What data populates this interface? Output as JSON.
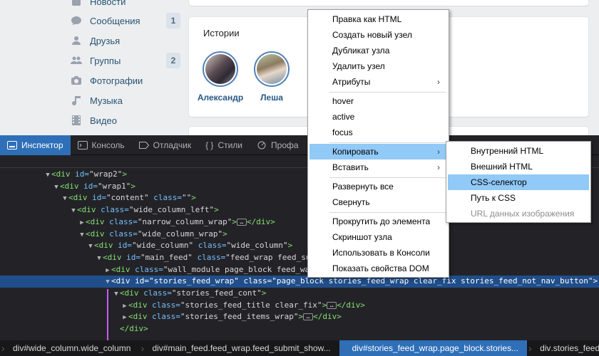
{
  "sidebar": {
    "items": [
      {
        "label": "Новости",
        "icon": "news-icon",
        "count": ""
      },
      {
        "label": "Сообщения",
        "icon": "messages-icon",
        "count": "1"
      },
      {
        "label": "Друзья",
        "icon": "friends-icon",
        "count": ""
      },
      {
        "label": "Группы",
        "icon": "groups-icon",
        "count": "2"
      },
      {
        "label": "Фотографии",
        "icon": "camera-icon",
        "count": ""
      },
      {
        "label": "Музыка",
        "icon": "music-note-icon",
        "count": ""
      },
      {
        "label": "Видео",
        "icon": "video-film-icon",
        "count": ""
      }
    ]
  },
  "stories": {
    "title": "Истории",
    "people": [
      {
        "name": "Александр"
      },
      {
        "name": "Леша"
      }
    ]
  },
  "devtools": {
    "tabs": [
      {
        "label": "Инспектор",
        "icon": "inspector-icon"
      },
      {
        "label": "Консоль",
        "icon": "console-icon"
      },
      {
        "label": "Отладчик",
        "icon": "debugger-icon"
      },
      {
        "label": "Стили",
        "icon": "style-editor-icon"
      },
      {
        "label": "Профа",
        "icon": "performance-icon"
      }
    ],
    "markup": [
      {
        "parts": [
          [
            "tg",
            "<div "
          ],
          [
            "at",
            "id="
          ],
          [
            "vl",
            "\"wrap2\""
          ],
          [
            "tg",
            ">"
          ]
        ]
      },
      {
        "parts": [
          [
            "tg",
            "<div "
          ],
          [
            "at",
            "id="
          ],
          [
            "vl",
            "\"wrap1\""
          ],
          [
            "tg",
            ">"
          ]
        ]
      },
      {
        "parts": [
          [
            "tg",
            "<div "
          ],
          [
            "at",
            "id="
          ],
          [
            "vl",
            "\"content\" "
          ],
          [
            "at",
            "class="
          ],
          [
            "vl",
            "\"\""
          ],
          [
            "tg",
            ">"
          ]
        ]
      },
      {
        "parts": [
          [
            "tg",
            "<div "
          ],
          [
            "at",
            "class="
          ],
          [
            "vl",
            "\"wide_column_left\""
          ],
          [
            "tg",
            ">"
          ]
        ]
      },
      {
        "parts": [
          [
            "tg",
            "<div "
          ],
          [
            "at",
            "class="
          ],
          [
            "vl",
            "\"narrow_column_wrap\""
          ],
          [
            "tg",
            ">"
          ],
          [
            "ell",
            "…"
          ],
          [
            "tg",
            "</div>"
          ]
        ]
      },
      {
        "parts": [
          [
            "tg",
            "<div "
          ],
          [
            "at",
            "class="
          ],
          [
            "vl",
            "\"wide_column_wrap\""
          ],
          [
            "tg",
            ">"
          ]
        ]
      },
      {
        "parts": [
          [
            "tg",
            "<div "
          ],
          [
            "at",
            "id="
          ],
          [
            "vl",
            "\"wide_column\" "
          ],
          [
            "at",
            "class="
          ],
          [
            "vl",
            "\"wide_column\""
          ],
          [
            "tg",
            ">"
          ]
        ]
      },
      {
        "parts": [
          [
            "tg",
            "<div "
          ],
          [
            "at",
            "id="
          ],
          [
            "vl",
            "\"main_feed\" "
          ],
          [
            "at",
            "class="
          ],
          [
            "vl",
            "\"feed_wrap feed_submit_shown\""
          ],
          [
            "tg",
            ">"
          ]
        ]
      },
      {
        "parts": [
          [
            "tg",
            "<div "
          ],
          [
            "at",
            "class="
          ],
          [
            "vl",
            "\"wall_module page_block feed_wall\""
          ],
          [
            "tg",
            ">"
          ]
        ]
      },
      {
        "parts": [
          [
            "tg",
            "<div "
          ],
          [
            "at",
            "id="
          ],
          [
            "vl",
            "\"stories_feed_wrap\" "
          ],
          [
            "at",
            "class="
          ],
          [
            "vl",
            "\"page_block stories_feed_wrap clear_fix stories_feed_not_nav_button\""
          ],
          [
            "tg",
            ">"
          ]
        ]
      },
      {
        "parts": [
          [
            "tg",
            "<div "
          ],
          [
            "at",
            "class="
          ],
          [
            "vl",
            "\"stories_feed_cont\""
          ],
          [
            "tg",
            ">"
          ]
        ]
      },
      {
        "parts": [
          [
            "tg",
            "<div "
          ],
          [
            "at",
            "class="
          ],
          [
            "vl",
            "\"stories_feed_title clear_fix\""
          ],
          [
            "tg",
            ">"
          ],
          [
            "ell",
            "…"
          ],
          [
            "tg",
            "</div>"
          ]
        ]
      },
      {
        "parts": [
          [
            "tg",
            "<div "
          ],
          [
            "at",
            "class="
          ],
          [
            "vl",
            "\"stories_feed_items_wrap\""
          ],
          [
            "tg",
            ">"
          ],
          [
            "ell",
            "…"
          ],
          [
            "tg",
            "</div>"
          ]
        ]
      },
      {
        "parts": [
          [
            "tg",
            "</div>"
          ]
        ]
      }
    ],
    "breadcrumbs": [
      {
        "tag": "div",
        "rest": "#wide_column.wide_column"
      },
      {
        "tag": "div",
        "rest": "#main_feed.feed_wrap.feed_submit_show..."
      },
      {
        "tag": "div",
        "rest": "#stories_feed_wrap.page_block.stories..."
      },
      {
        "tag": "div",
        "rest": ".stories_feed_cont"
      }
    ]
  },
  "context_menu": {
    "items": [
      {
        "label": "Правка как HTML",
        "key": "edit_html"
      },
      {
        "label": "Создать новый узел",
        "key": "new_node"
      },
      {
        "label": "Дубликат узла",
        "key": "duplicate"
      },
      {
        "label": "Удалить узел",
        "key": "delete"
      },
      {
        "label": "Атрибуты",
        "key": "attributes"
      },
      {
        "label": "hover",
        "key": "hover"
      },
      {
        "label": "active",
        "key": "active"
      },
      {
        "label": "focus",
        "key": "focus"
      },
      {
        "label": "Копировать",
        "key": "copy"
      },
      {
        "label": "Вставить",
        "key": "paste"
      },
      {
        "label": "Развернуть все",
        "key": "expand_all"
      },
      {
        "label": "Свернуть",
        "key": "collapse"
      },
      {
        "label": "Прокрутить до элемента",
        "key": "scroll_into_view"
      },
      {
        "label": "Скриншот узла",
        "key": "screenshot"
      },
      {
        "label": "Использовать в Консоли",
        "key": "use_in_console"
      },
      {
        "label": "Показать свойства DOM",
        "key": "show_dom"
      }
    ],
    "submenu": [
      {
        "label": "Внутренний HTML"
      },
      {
        "label": "Внешний HTML"
      },
      {
        "label": "CSS-селектор"
      },
      {
        "label": "Путь к CSS"
      },
      {
        "label": "URL данных изображения"
      }
    ]
  },
  "colors": {
    "accent": "#2e6fb8",
    "menu_highlight": "#91c9f7",
    "vk_link": "#285473"
  }
}
